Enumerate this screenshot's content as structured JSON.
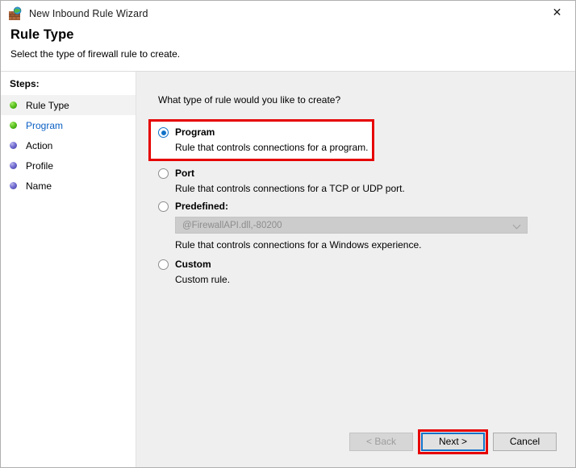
{
  "window": {
    "title": "New Inbound Rule Wizard",
    "icon": "firewall-brick-globe-icon",
    "close_label": "✕"
  },
  "header": {
    "title": "Rule Type",
    "subtitle": "Select the type of firewall rule to create."
  },
  "sidebar": {
    "heading": "Steps:",
    "items": [
      {
        "label": "Rule Type",
        "bullet": "green",
        "state": "current"
      },
      {
        "label": "Program",
        "bullet": "green",
        "state": "link"
      },
      {
        "label": "Action",
        "bullet": "blue",
        "state": "pending"
      },
      {
        "label": "Profile",
        "bullet": "blue",
        "state": "pending"
      },
      {
        "label": "Name",
        "bullet": "blue",
        "state": "pending"
      }
    ]
  },
  "main": {
    "question": "What type of rule would you like to create?",
    "options": [
      {
        "title": "Program",
        "description": "Rule that controls connections for a program.",
        "selected": true,
        "highlighted": true
      },
      {
        "title": "Port",
        "description": "Rule that controls connections for a TCP or UDP port.",
        "selected": false,
        "highlighted": false
      },
      {
        "title": "Predefined:",
        "description": "Rule that controls connections for a Windows experience.",
        "selected": false,
        "highlighted": false,
        "combo_value": "@FirewallAPI.dll,-80200",
        "combo_disabled": true
      },
      {
        "title": "Custom",
        "description": "Custom rule.",
        "selected": false,
        "highlighted": false
      }
    ]
  },
  "footer": {
    "back_label": "< Back",
    "next_label": "Next >",
    "cancel_label": "Cancel"
  },
  "colors": {
    "accent_blue": "#1272c8",
    "highlight_red": "#e60000",
    "link_blue": "#0a5fc4",
    "content_bg": "#efefef"
  }
}
